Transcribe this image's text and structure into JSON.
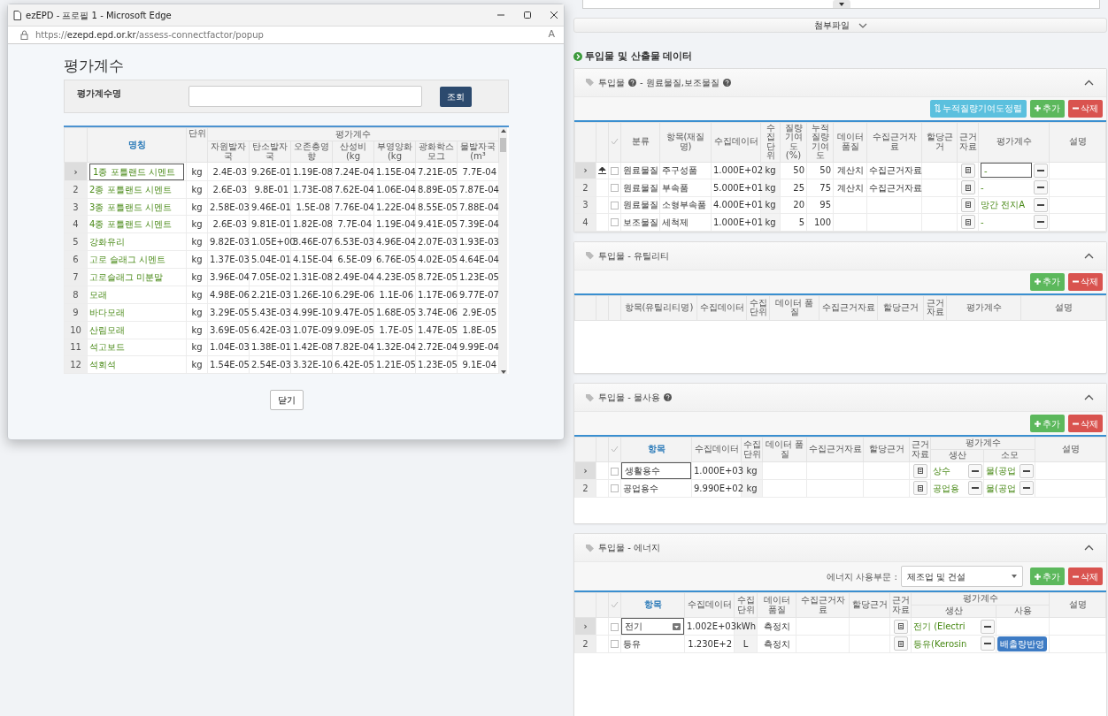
{
  "popup": {
    "window_title": "ezEPD - 프로필 1 - Microsoft Edge",
    "url": "https://**ezepd.epd.or.kr**/assess-connectfactor/popup",
    "read_aloud": "A",
    "heading": "평가계수",
    "search_label": "평가계수명",
    "search_button": "조회",
    "table": {
      "name_header": "명칭",
      "unit_header": "단위",
      "group_header": "평가계수",
      "value_headers": [
        "자원발자국",
        "탄소발자국",
        "오존층영향",
        "산성비 (kg",
        "부영양화 (kg",
        "광화학스모그",
        "물발자국 (m³"
      ],
      "rows": [
        {
          "marker": "›",
          "selected": true,
          "name": "1종 포틀랜드 시멘트",
          "unit": "kg",
          "values": [
            "2.4E-03",
            "9.26E-01",
            "1.19E-08",
            "7.24E-04",
            "1.15E-04",
            "7.21E-05",
            "7.7E-04"
          ]
        },
        {
          "marker": "2",
          "selected": false,
          "name": "2종 포틀랜드 시멘트",
          "unit": "kg",
          "values": [
            "2.6E-03",
            "9.8E-01",
            "1.73E-08",
            "7.62E-04",
            "1.06E-04",
            "8.89E-05",
            "7.87E-04"
          ]
        },
        {
          "marker": "3",
          "selected": false,
          "name": "3종 포틀랜드 시멘트",
          "unit": "kg",
          "values": [
            "2.58E-03",
            "9.46E-01",
            "1.5E-08",
            "7.76E-04",
            "1.22E-04",
            "8.55E-05",
            "7.88E-04"
          ]
        },
        {
          "marker": "4",
          "selected": false,
          "name": "4종 포틀랜드 시멘트",
          "unit": "kg",
          "values": [
            "2.6E-03",
            "9.81E-01",
            "1.82E-08",
            "7.7E-04",
            "1.19E-04",
            "9.41E-05",
            "7.39E-04"
          ]
        },
        {
          "marker": "5",
          "selected": false,
          "name": "강화유리",
          "unit": "kg",
          "values": [
            "9.82E-03",
            "1.05E+00",
            "3.46E-07",
            "6.53E-03",
            "4.96E-04",
            "2.07E-03",
            "1.93E-03"
          ]
        },
        {
          "marker": "6",
          "selected": false,
          "name": "고로 슬래그 시멘트",
          "unit": "kg",
          "values": [
            "1.37E-03",
            "5.04E-01",
            "4.15E-04",
            "6.5E-09",
            "6.76E-05",
            "4.02E-05",
            "4.64E-04"
          ]
        },
        {
          "marker": "7",
          "selected": false,
          "name": "고로슬래그 미분말",
          "unit": "kg",
          "values": [
            "3.96E-04",
            "7.05E-02",
            "1.31E-08",
            "2.49E-04",
            "4.23E-05",
            "8.72E-05",
            "1.23E-05"
          ]
        },
        {
          "marker": "8",
          "selected": false,
          "name": "모래",
          "unit": "kg",
          "values": [
            "4.98E-06",
            "2.21E-03",
            "1.26E-10",
            "6.29E-06",
            "1.1E-06",
            "1.17E-06",
            "9.77E-07"
          ]
        },
        {
          "marker": "9",
          "selected": false,
          "name": "바다모래",
          "unit": "kg",
          "values": [
            "3.29E-05",
            "5.43E-03",
            "4.99E-10",
            "9.47E-05",
            "1.68E-05",
            "3.74E-06",
            "2.9E-05"
          ]
        },
        {
          "marker": "10",
          "selected": false,
          "name": "산림모래",
          "unit": "kg",
          "values": [
            "3.69E-05",
            "6.42E-03",
            "1.07E-09",
            "9.09E-05",
            "1.7E-05",
            "1.47E-05",
            "1.8E-05"
          ]
        },
        {
          "marker": "11",
          "selected": false,
          "name": "석고보드",
          "unit": "kg",
          "values": [
            "1.04E-03",
            "1.38E-01",
            "1.42E-08",
            "7.82E-04",
            "1.32E-04",
            "2.72E-04",
            "9.99E-04"
          ]
        },
        {
          "marker": "12",
          "selected": false,
          "name": "석회석",
          "unit": "kg",
          "values": [
            "1.54E-05",
            "2.54E-03",
            "3.32E-10",
            "6.42E-05",
            "1.21E-05",
            "1.23E-05",
            "9.1E-04"
          ]
        }
      ]
    },
    "close_button": "닫기"
  },
  "attachments_bar": "첨부파일",
  "section_title": "투입물 및 산출물 데이터",
  "panels": [
    {
      "title": [
        {
          "text": "투입물",
          "help": true
        },
        {
          "text": "- 원료물질,보조물질",
          "help": true
        }
      ],
      "toolbar": [
        {
          "kind": "sort",
          "label": "누적질량기여도정렬"
        },
        {
          "kind": "add",
          "label": "추가"
        },
        {
          "kind": "delete",
          "label": "삭제"
        }
      ],
      "header_check": true,
      "columns": [
        {
          "label": "분류",
          "highlight": false
        },
        {
          "label": "항목(재질명)",
          "highlight": false
        },
        {
          "label": "수집데이터",
          "highlight": false
        },
        {
          "label": "수집단위",
          "highlight": false
        },
        {
          "label": "질량기여도(%)",
          "highlight": false
        },
        {
          "label": "누적질량기여도",
          "highlight": false
        },
        {
          "label": "데이터품질",
          "highlight": false
        },
        {
          "label": "수집근거자료",
          "highlight": false
        },
        {
          "label": "할당근거",
          "highlight": false
        },
        {
          "label": "근거자료",
          "highlight": false
        },
        {
          "label": "평가계수",
          "highlight": false
        },
        {
          "label": "설명",
          "highlight": false
        }
      ],
      "rows": [
        {
          "marker": "›",
          "selected": true,
          "move_icon": true,
          "checked": false,
          "cells": [
            {
              "kind": "text",
              "text": "원료물질"
            },
            {
              "kind": "text",
              "text": "주구성품"
            },
            {
              "kind": "num",
              "text": "1.000E+02"
            },
            {
              "kind": "unit",
              "text": "kg"
            },
            {
              "kind": "num",
              "text": "50"
            },
            {
              "kind": "num",
              "text": "50"
            },
            {
              "kind": "center",
              "text": "계산치"
            },
            {
              "kind": "text",
              "text": "수집근거자료"
            },
            {
              "kind": "blank"
            },
            {
              "kind": "doc"
            },
            {
              "kind": "factor-edit",
              "text": "-"
            },
            {
              "kind": "blank"
            }
          ]
        },
        {
          "marker": "2",
          "selected": false,
          "move_icon": false,
          "checked": false,
          "cells": [
            {
              "kind": "text",
              "text": "원료물질"
            },
            {
              "kind": "text",
              "text": "부속품"
            },
            {
              "kind": "num",
              "text": "5.000E+01"
            },
            {
              "kind": "unit",
              "text": "kg"
            },
            {
              "kind": "num",
              "text": "25"
            },
            {
              "kind": "num",
              "text": "75"
            },
            {
              "kind": "center",
              "text": "계산치"
            },
            {
              "kind": "text",
              "text": "수집근거자료"
            },
            {
              "kind": "blank"
            },
            {
              "kind": "doc"
            },
            {
              "kind": "factor",
              "text": "-"
            },
            {
              "kind": "blank"
            }
          ]
        },
        {
          "marker": "3",
          "selected": false,
          "move_icon": false,
          "checked": false,
          "cells": [
            {
              "kind": "text",
              "text": "원료물질"
            },
            {
              "kind": "text",
              "text": "소형부속품"
            },
            {
              "kind": "num",
              "text": "4.000E+01"
            },
            {
              "kind": "unit",
              "text": "kg"
            },
            {
              "kind": "num",
              "text": "20"
            },
            {
              "kind": "num",
              "text": "95"
            },
            {
              "kind": "blank"
            },
            {
              "kind": "blank"
            },
            {
              "kind": "blank"
            },
            {
              "kind": "doc"
            },
            {
              "kind": "factor",
              "text": "망간 전지A"
            },
            {
              "kind": "blank"
            }
          ]
        },
        {
          "marker": "4",
          "selected": false,
          "move_icon": false,
          "checked": false,
          "cells": [
            {
              "kind": "text",
              "text": "보조물질"
            },
            {
              "kind": "text",
              "text": "세척제"
            },
            {
              "kind": "num",
              "text": "1.000E+01"
            },
            {
              "kind": "unit",
              "text": "kg"
            },
            {
              "kind": "num",
              "text": "5"
            },
            {
              "kind": "num",
              "text": "100"
            },
            {
              "kind": "blank"
            },
            {
              "kind": "blank"
            },
            {
              "kind": "blank"
            },
            {
              "kind": "doc"
            },
            {
              "kind": "factor",
              "text": "-"
            },
            {
              "kind": "blank"
            }
          ]
        }
      ]
    },
    {
      "title": [
        {
          "text": "투입물 - 유틸리티",
          "help": false
        }
      ],
      "toolbar": [
        {
          "kind": "add",
          "label": "추가"
        },
        {
          "kind": "delete",
          "label": "삭제"
        }
      ],
      "header_check": false,
      "columns": [
        {
          "label": "항목(유틸리티명)",
          "highlight": false
        },
        {
          "label": "수집데이터",
          "highlight": false
        },
        {
          "label": "수집단위",
          "highlight": false
        },
        {
          "label": "데이터 품질",
          "highlight": false
        },
        {
          "label": "수집근거자료",
          "highlight": false
        },
        {
          "label": "할당근거",
          "highlight": false
        },
        {
          "label": "근거자료",
          "highlight": false
        },
        {
          "label": "평가계수",
          "highlight": false
        },
        {
          "label": "설명",
          "highlight": false
        }
      ]
    },
    {
      "title": [
        {
          "text": "투입물 - 물사용",
          "help": true
        }
      ],
      "toolbar": [
        {
          "kind": "add",
          "label": "추가"
        },
        {
          "kind": "delete",
          "label": "삭제"
        }
      ],
      "header_check": true,
      "columns": [
        {
          "label": "항목",
          "highlight": true
        },
        {
          "label": "수집데이터",
          "highlight": false
        },
        {
          "label": "수집단위",
          "highlight": false
        },
        {
          "label": "데이터 품질",
          "highlight": false
        },
        {
          "label": "수집근거자료",
          "highlight": false
        },
        {
          "label": "할당근거",
          "highlight": false
        },
        {
          "label": "근거자료",
          "highlight": false
        },
        {
          "label": "평가계수",
          "highlight": false,
          "colspan": 2,
          "sub": [
            "생산",
            "소모"
          ]
        },
        {
          "label": "설명",
          "highlight": false
        }
      ],
      "rows": [
        {
          "marker": "›",
          "selected": true,
          "move_icon": false,
          "checked": false,
          "cells": [
            {
              "kind": "editor",
              "text": "생활용수"
            },
            {
              "kind": "num",
              "text": "1.000E+03"
            },
            {
              "kind": "unit",
              "text": "kg"
            },
            {
              "kind": "blank"
            },
            {
              "kind": "blank"
            },
            {
              "kind": "blank"
            },
            {
              "kind": "doc"
            },
            {
              "kind": "factor",
              "text": "상수"
            },
            {
              "kind": "factor",
              "text": "물(공업"
            },
            {
              "kind": "blank"
            }
          ]
        },
        {
          "marker": "2",
          "selected": false,
          "move_icon": false,
          "checked": false,
          "cells": [
            {
              "kind": "text",
              "text": "공업용수"
            },
            {
              "kind": "num",
              "text": "9.990E+02"
            },
            {
              "kind": "unit",
              "text": "kg"
            },
            {
              "kind": "blank"
            },
            {
              "kind": "blank"
            },
            {
              "kind": "blank"
            },
            {
              "kind": "doc"
            },
            {
              "kind": "factor",
              "text": "공업용"
            },
            {
              "kind": "factor",
              "text": "물(공업"
            },
            {
              "kind": "blank"
            }
          ]
        }
      ]
    },
    {
      "title": [
        {
          "text": "투입물 - 에너지",
          "help": false
        }
      ],
      "select": {
        "label": "에너지 사용부문 :",
        "value": "제조업 및 건설"
      },
      "toolbar": [
        {
          "kind": "add",
          "label": "추가"
        },
        {
          "kind": "delete",
          "label": "삭제"
        }
      ],
      "header_check": true,
      "columns": [
        {
          "label": "항목",
          "highlight": true
        },
        {
          "label": "수집데이터",
          "highlight": false
        },
        {
          "label": "수집단위",
          "highlight": false
        },
        {
          "label": "데이터 품질",
          "highlight": false
        },
        {
          "label": "수집근거자료",
          "highlight": false
        },
        {
          "label": "할당근거",
          "highlight": false
        },
        {
          "label": "근거자료",
          "highlight": false
        },
        {
          "label": "평가계수",
          "highlight": false,
          "colspan": 2,
          "sub": [
            "생산",
            "사용"
          ]
        },
        {
          "label": "설명",
          "highlight": false
        }
      ],
      "rows": [
        {
          "marker": "›",
          "selected": true,
          "move_icon": false,
          "checked": false,
          "cells": [
            {
              "kind": "dropdown",
              "text": "전기"
            },
            {
              "kind": "num",
              "text": "1.002E+03"
            },
            {
              "kind": "unit",
              "text": "kWh"
            },
            {
              "kind": "center",
              "text": "측정치"
            },
            {
              "kind": "blank"
            },
            {
              "kind": "blank"
            },
            {
              "kind": "doc"
            },
            {
              "kind": "factor",
              "text": "전기 (Electri"
            },
            {
              "kind": "blank"
            },
            {
              "kind": "blank"
            }
          ]
        },
        {
          "marker": "2",
          "selected": false,
          "move_icon": false,
          "checked": false,
          "cells": [
            {
              "kind": "text",
              "text": "등유"
            },
            {
              "kind": "num",
              "text": "1.230E+2"
            },
            {
              "kind": "unit",
              "text": "L"
            },
            {
              "kind": "center",
              "text": "측정치"
            },
            {
              "kind": "blank"
            },
            {
              "kind": "blank"
            },
            {
              "kind": "doc"
            },
            {
              "kind": "factor",
              "text": "등유(Kerosin"
            },
            {
              "kind": "badge",
              "text": "배출량반영"
            },
            {
              "kind": "blank"
            }
          ]
        }
      ]
    }
  ]
}
